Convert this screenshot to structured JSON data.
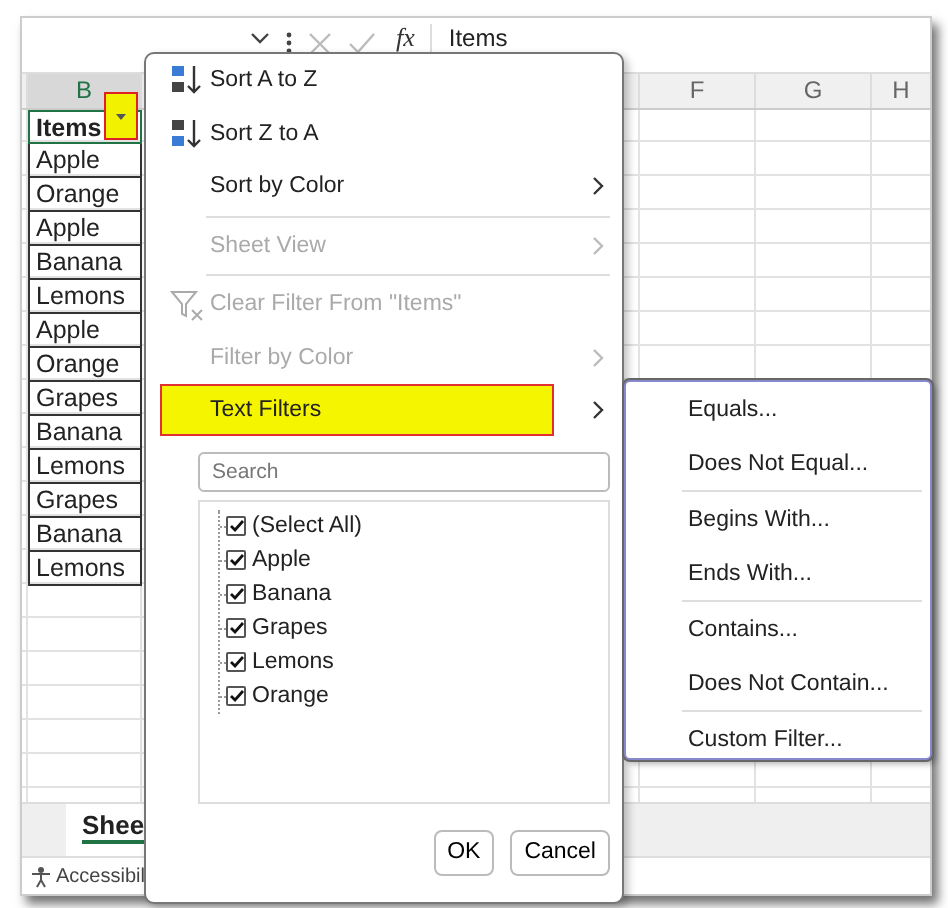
{
  "formula_bar": {
    "function_label": "fx",
    "formula": "Items"
  },
  "sheet": {
    "columns": [
      {
        "label": "B"
      },
      {
        "label": "F"
      },
      {
        "label": "G"
      },
      {
        "label": "H"
      }
    ],
    "header_cell": "Items",
    "rows": [
      "Apple",
      "Orange",
      "Apple",
      "Banana",
      "Lemons",
      "Apple",
      "Orange",
      "Grapes",
      "Banana",
      "Lemons",
      "Grapes",
      "Banana",
      "Lemons"
    ],
    "sheet_tab": "Shee",
    "status": "Accessibil"
  },
  "filter_menu": {
    "items": [
      {
        "label": "Sort A to Z",
        "kind": "sort_az",
        "disabled": false,
        "selected": false,
        "submenu": false,
        "divider_before": false
      },
      {
        "label": "Sort Z to A",
        "kind": "sort_za",
        "disabled": false,
        "selected": false,
        "submenu": false,
        "divider_before": false
      },
      {
        "label": "Sort by Color",
        "kind": "plain",
        "disabled": false,
        "selected": false,
        "submenu": true,
        "divider_before": false
      },
      {
        "label": "Sheet View",
        "kind": "plain",
        "disabled": true,
        "selected": false,
        "submenu": true,
        "divider_before": true
      },
      {
        "label": "Clear Filter From \"Items\"",
        "kind": "clear_filter",
        "disabled": true,
        "selected": false,
        "submenu": false,
        "divider_before": true
      },
      {
        "label": "Filter by Color",
        "kind": "plain",
        "disabled": true,
        "selected": false,
        "submenu": true,
        "divider_before": false
      },
      {
        "label": "Text Filters",
        "kind": "plain",
        "disabled": false,
        "selected": true,
        "submenu": true,
        "divider_before": false
      }
    ],
    "search": {
      "placeholder": "Search"
    },
    "values": [
      {
        "label": "(Select All)",
        "checked": true
      },
      {
        "label": "Apple",
        "checked": true
      },
      {
        "label": "Banana",
        "checked": true
      },
      {
        "label": "Grapes",
        "checked": true
      },
      {
        "label": "Lemons",
        "checked": true
      },
      {
        "label": "Orange",
        "checked": true
      }
    ],
    "buttons": [
      "OK",
      "Cancel"
    ]
  },
  "text_filters_menu": {
    "groups": [
      [
        "Equals...",
        "Does Not Equal..."
      ],
      [
        "Begins With...",
        "Ends With..."
      ],
      [
        "Contains...",
        "Does Not Contain..."
      ],
      [
        "Custom Filter..."
      ]
    ]
  }
}
